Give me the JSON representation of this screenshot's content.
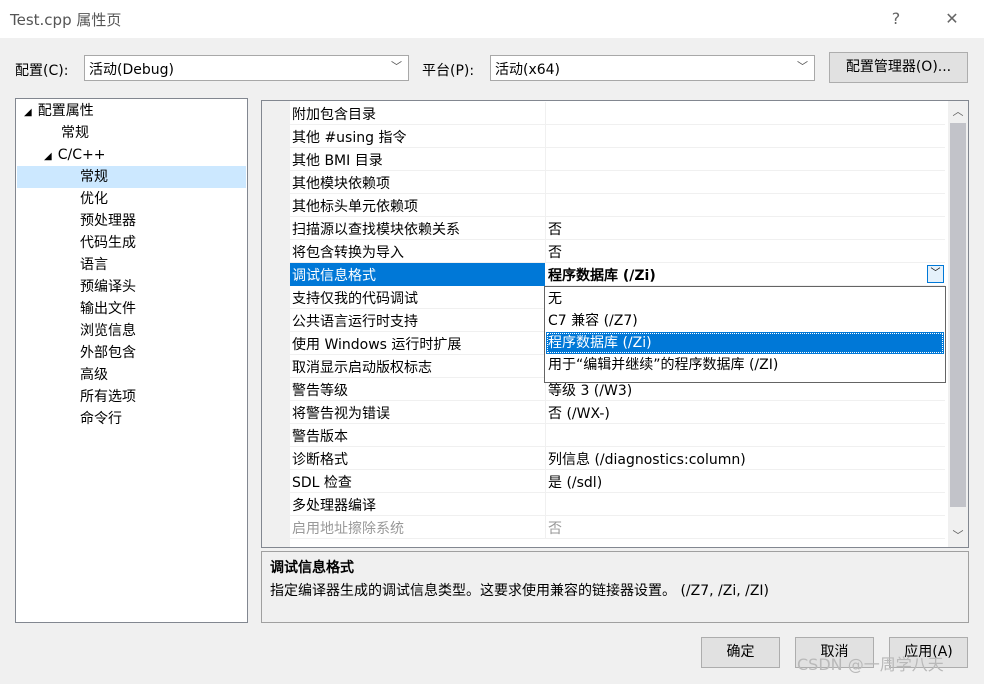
{
  "window": {
    "title": "Test.cpp 属性页",
    "help": "?",
    "close": "✕"
  },
  "config": {
    "config_label": "配置(C):",
    "config_value": "活动(Debug)",
    "platform_label": "平台(P):",
    "platform_value": "活动(x64)",
    "manager_button": "配置管理器(O)..."
  },
  "tree": {
    "items": [
      {
        "label": "配置属性",
        "glyph": "◢"
      },
      {
        "label": "常规"
      },
      {
        "label": "C/C++",
        "glyph": "◢"
      },
      {
        "label": "常规"
      },
      {
        "label": "优化"
      },
      {
        "label": "预处理器"
      },
      {
        "label": "代码生成"
      },
      {
        "label": "语言"
      },
      {
        "label": "预编译头"
      },
      {
        "label": "输出文件"
      },
      {
        "label": "浏览信息"
      },
      {
        "label": "外部包含"
      },
      {
        "label": "高级"
      },
      {
        "label": "所有选项"
      },
      {
        "label": "命令行"
      }
    ]
  },
  "grid": {
    "rows": [
      {
        "name": "附加包含目录",
        "value": ""
      },
      {
        "name": "其他 #using 指令",
        "value": ""
      },
      {
        "name": "其他 BMI 目录",
        "value": ""
      },
      {
        "name": "其他模块依赖项",
        "value": ""
      },
      {
        "name": "其他标头单元依赖项",
        "value": ""
      },
      {
        "name": "扫描源以查找模块依赖关系",
        "value": "否"
      },
      {
        "name": "将包含转换为导入",
        "value": "否"
      },
      {
        "name": "调试信息格式",
        "value": "程序数据库 (/Zi)"
      },
      {
        "name": "支持仅我的代码调试",
        "value": ""
      },
      {
        "name": "公共语言运行时支持",
        "value": ""
      },
      {
        "name": "使用 Windows 运行时扩展",
        "value": ""
      },
      {
        "name": "取消显示启动版权标志",
        "value": ""
      },
      {
        "name": "警告等级",
        "value": "等级 3 (/W3)"
      },
      {
        "name": "将警告视为错误",
        "value": "否 (/WX-)"
      },
      {
        "name": "警告版本",
        "value": ""
      },
      {
        "name": "诊断格式",
        "value": "列信息 (/diagnostics:column)"
      },
      {
        "name": "SDL 检查",
        "value": "是 (/sdl)"
      },
      {
        "name": "多处理器编译",
        "value": ""
      },
      {
        "name": "启用地址擦除系统",
        "value": "否"
      }
    ],
    "dropdown_options": [
      "无",
      "C7 兼容 (/Z7)",
      "程序数据库 (/Zi)",
      "用于“编辑并继续”的程序数据库 (/ZI)"
    ]
  },
  "description": {
    "title": "调试信息格式",
    "text": "指定编译器生成的调试信息类型。这要求使用兼容的链接器设置。  (/Z7, /Zi, /ZI)"
  },
  "buttons": {
    "ok": "确定",
    "cancel": "取消",
    "apply": "应用(A)"
  },
  "watermark": "CSDN @一周学八天",
  "colors": {
    "accent": "#0078d7",
    "tree_selected": "#cce8ff"
  }
}
